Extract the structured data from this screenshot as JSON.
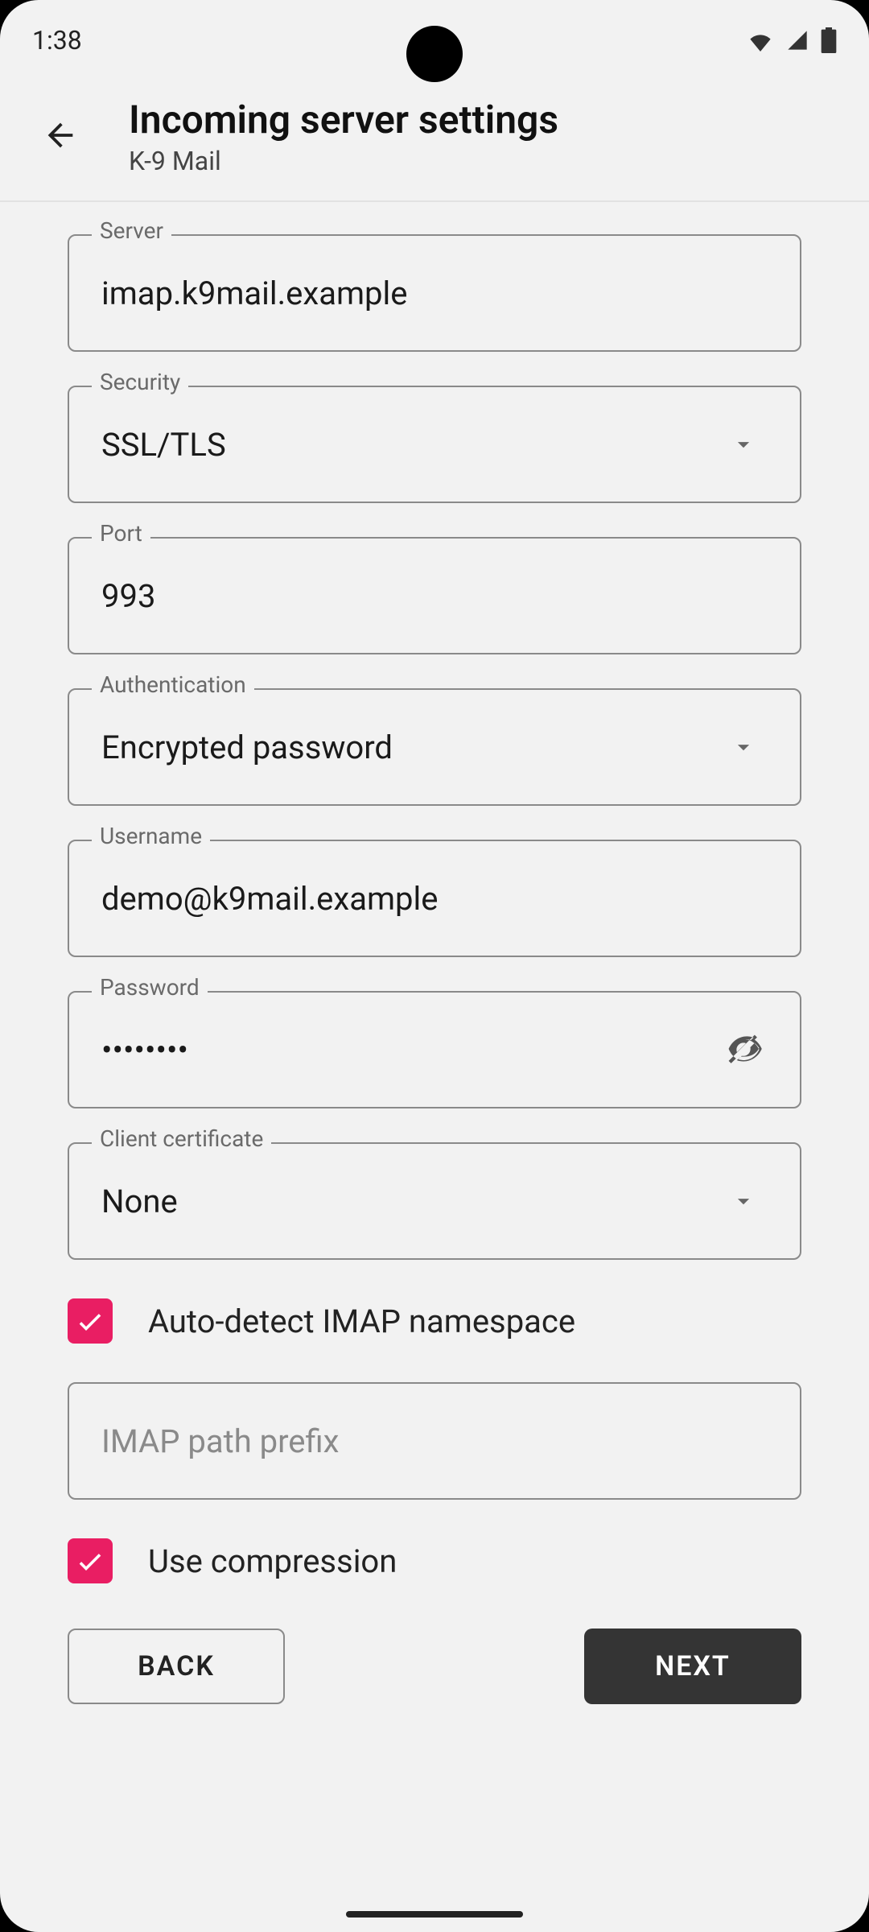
{
  "status": {
    "time": "1:38"
  },
  "header": {
    "title": "Incoming server settings",
    "subtitle": "K-9 Mail"
  },
  "fields": {
    "server": {
      "label": "Server",
      "value": "imap.k9mail.example"
    },
    "security": {
      "label": "Security",
      "value": "SSL/TLS"
    },
    "port": {
      "label": "Port",
      "value": "993"
    },
    "authentication": {
      "label": "Authentication",
      "value": "Encrypted password"
    },
    "username": {
      "label": "Username",
      "value": "demo@k9mail.example"
    },
    "password": {
      "label": "Password",
      "value": "••••••••"
    },
    "client_cert": {
      "label": "Client certificate",
      "value": "None"
    },
    "imap_prefix": {
      "placeholder": "IMAP path prefix",
      "value": ""
    }
  },
  "checkboxes": {
    "auto_detect": {
      "label": "Auto-detect IMAP namespace",
      "checked": true
    },
    "compression": {
      "label": "Use compression",
      "checked": true
    }
  },
  "footer": {
    "back": "BACK",
    "next": "NEXT"
  },
  "colors": {
    "accent": "#e91e63",
    "button_dark": "#343434"
  }
}
